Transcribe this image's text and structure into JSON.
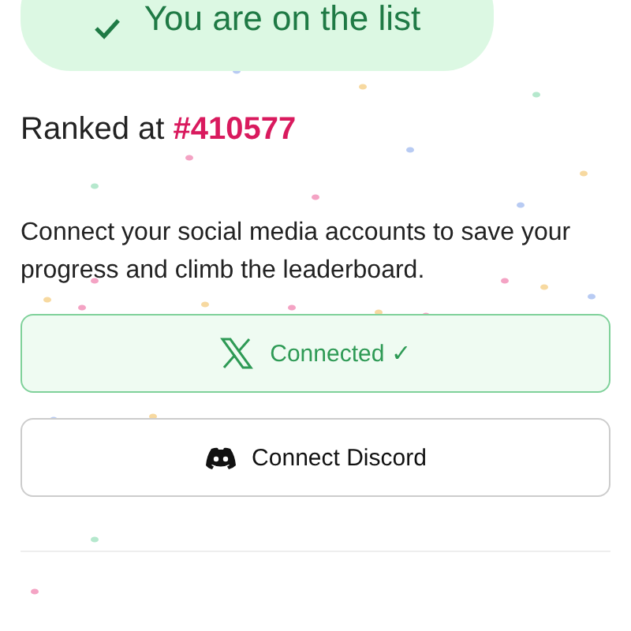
{
  "banner": {
    "text": "You are on the list"
  },
  "rank": {
    "label": "Ranked at",
    "value": "#410577"
  },
  "message": "Connect your social media accounts to save your progress and climb the leaderboard.",
  "accounts": [
    {
      "kind": "x",
      "label": "Connected ✓",
      "connected": true
    },
    {
      "kind": "discord",
      "label": "Connect Discord",
      "connected": false
    }
  ]
}
